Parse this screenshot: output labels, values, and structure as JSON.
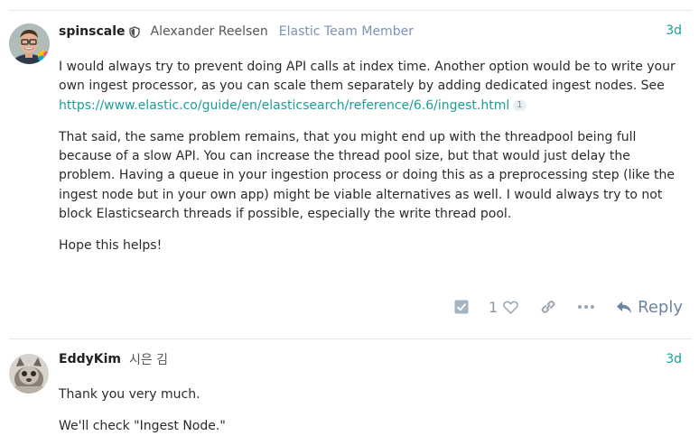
{
  "posts": [
    {
      "username": "spinscale",
      "full_name": "Alexander Reelsen",
      "user_title": "Elastic Team Member",
      "date": "3d",
      "paragraphs": [
        {
          "text": "I would always try to prevent doing API calls at index time. Another option would be to write your own ingest processor, as you can scale them separately by adding dedicated ingest nodes. See",
          "link": "https://www.elastic.co/guide/en/elasticsearch/reference/6.6/ingest.html",
          "link_clicks": "1"
        },
        {
          "text": "That said, the same problem remains, that you might end up with the threadpool being full because of a slow API. You can increase the thread pool size, but that would just delay the problem. Having a queue in your ingestion process or doing this as a preprocessing step (like the ingest node but in your own app) might be viable alternatives as well. I would always try to not block Elasticsearch threads if possible, especially the write thread pool."
        },
        {
          "text": "Hope this helps!"
        }
      ],
      "like_count": "1",
      "reply_label": "Reply",
      "icons": [
        "shield-icon",
        "check-square-icon",
        "heart-icon",
        "link-icon",
        "more-icon",
        "reply-icon"
      ]
    },
    {
      "username": "EddyKim",
      "full_name": "시은 김",
      "date": "3d",
      "paragraphs": [
        {
          "text": "Thank you very much."
        },
        {
          "text": "We'll check \"Ingest Node.\""
        }
      ]
    }
  ],
  "colors": {
    "accent_teal": "#1a9e9a",
    "title_blue": "#7a94b8",
    "icon_gray": "#9aa6b2",
    "reply_blue": "#6c84a4"
  }
}
